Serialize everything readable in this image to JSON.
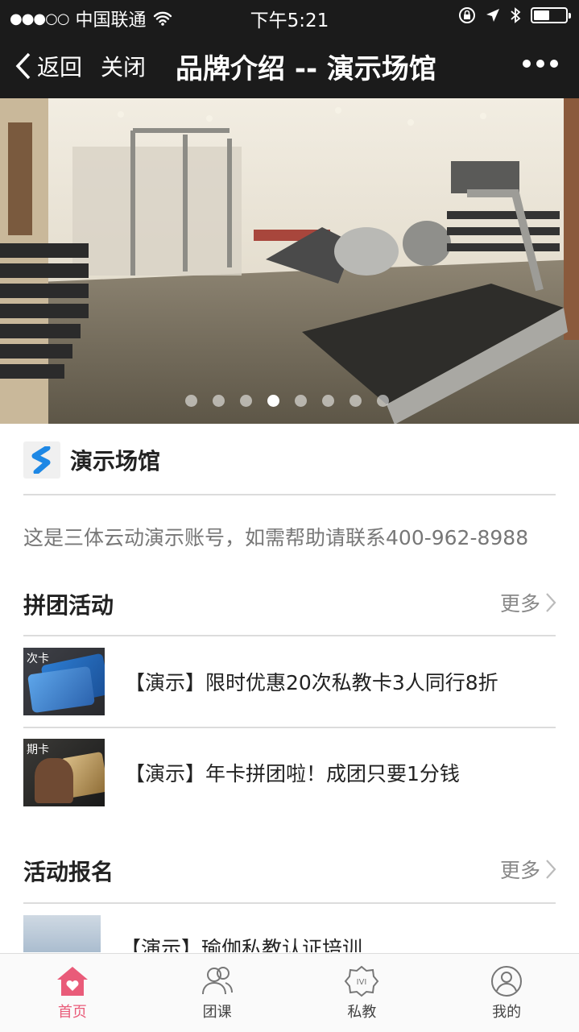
{
  "status": {
    "carrier": "中国联通",
    "time": "下午5:21",
    "battery_level": 0.5
  },
  "nav": {
    "back_label": "返回",
    "close_label": "关闭",
    "title": "品牌介绍 -- 演示场馆"
  },
  "banner": {
    "slide_count": 8,
    "active_slide": 4
  },
  "venue": {
    "name": "演示场馆",
    "description": "这是三体云动演示账号，如需帮助请联系400-962-8988"
  },
  "group_buy": {
    "title": "拼团活动",
    "more_label": "更多",
    "items": [
      {
        "tag": "次卡",
        "text": "【演示】限时优惠20次私教卡3人同行8折"
      },
      {
        "tag": "期卡",
        "text": "【演示】年卡拼团啦！成团只要1分钱"
      }
    ]
  },
  "events": {
    "title": "活动报名",
    "more_label": "更多",
    "items": [
      {
        "text": "【演示】瑜伽私教认证培训"
      }
    ]
  },
  "tabbar": {
    "items": [
      {
        "label": "首页",
        "icon": "home-icon",
        "active": true
      },
      {
        "label": "团课",
        "icon": "group-class-icon",
        "active": false
      },
      {
        "label": "私教",
        "icon": "personal-trainer-icon",
        "active": false
      },
      {
        "label": "我的",
        "icon": "profile-icon",
        "active": false
      }
    ]
  },
  "colors": {
    "accent": "#e95b79",
    "nav_bg": "#1b1b1b",
    "brand_blue": "#1e88e5"
  }
}
